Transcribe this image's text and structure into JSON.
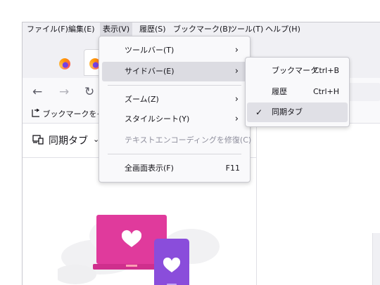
{
  "menubar": {
    "items": [
      {
        "label": "ファイル(F)"
      },
      {
        "label": "編集(E)"
      },
      {
        "label": "表示(V)"
      },
      {
        "label": "履歴(S)"
      },
      {
        "label": "ブックマーク(B)"
      },
      {
        "label": "ツール(T)"
      },
      {
        "label": "ヘルプ(H)"
      }
    ]
  },
  "bookmarks_toolbar": {
    "import_label": "ブックマークをイン"
  },
  "sidebar": {
    "title": "同期タブ"
  },
  "view_menu": {
    "items": [
      {
        "label": "ツールバー(T)",
        "arrow": "›"
      },
      {
        "label": "サイドバー(E)",
        "arrow": "›"
      },
      {
        "label": "ズーム(Z)",
        "arrow": "›"
      },
      {
        "label": "スタイルシート(Y)",
        "arrow": "›"
      },
      {
        "label": "テキストエンコーディングを修復(C)"
      },
      {
        "label": "全画面表示(F)",
        "shortcut": "F11"
      }
    ]
  },
  "sidebar_submenu": {
    "items": [
      {
        "label": "ブックマーク",
        "shortcut": "Ctrl+B"
      },
      {
        "label": "履歴",
        "shortcut": "Ctrl+H"
      },
      {
        "label": "同期タブ",
        "checkmark": "✓"
      }
    ]
  },
  "icons": {
    "back": "←",
    "forward": "→",
    "reload": "↻"
  },
  "colors": {
    "menu_highlight": "#dcdce2",
    "illustration_pink": "#e03a9c",
    "illustration_purple": "#8a4ddb"
  }
}
